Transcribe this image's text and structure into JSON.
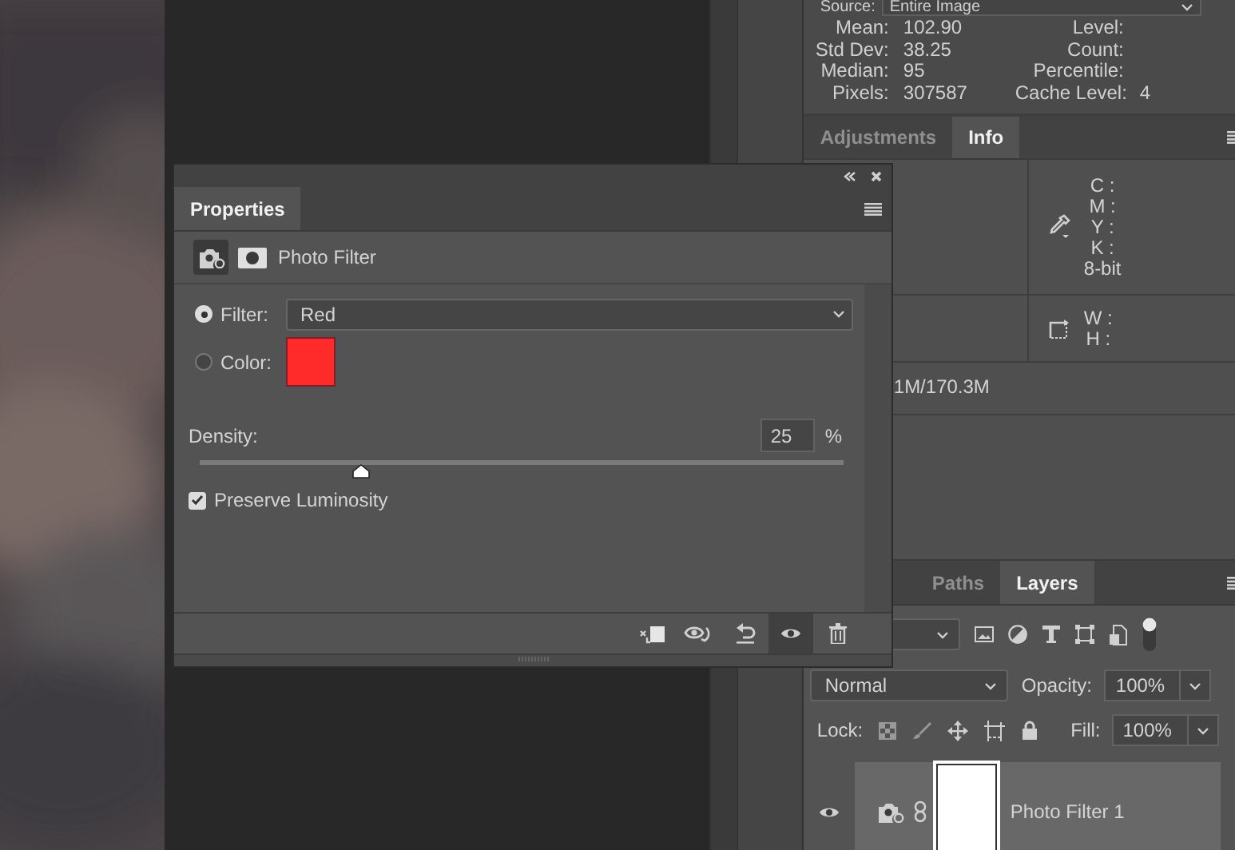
{
  "histogram": {
    "source_label": "Source:",
    "source_value": "Entire Image",
    "stats_left": [
      {
        "label": "Mean:",
        "value": "102.90"
      },
      {
        "label": "Std Dev:",
        "value": "38.25"
      },
      {
        "label": "Median:",
        "value": "95"
      },
      {
        "label": "Pixels:",
        "value": "307587"
      }
    ],
    "stats_right": [
      {
        "label": "Level:"
      },
      {
        "label": "Count:"
      },
      {
        "label": "Percentile:"
      },
      {
        "label": "Cache Level:",
        "value": "4"
      }
    ]
  },
  "info_panel": {
    "tabs": [
      {
        "label": "Adjustments",
        "selected": false
      },
      {
        "label": "Info",
        "selected": true
      }
    ],
    "cmyk_labels": [
      "C :",
      "M :",
      "Y :",
      "K :"
    ],
    "bit_depth": "8-bit",
    "size_labels": [
      "W :",
      "H :"
    ],
    "doc_size": "1M/170.3M"
  },
  "layers_panel": {
    "tabs": [
      {
        "label": "Paths",
        "selected": false
      },
      {
        "label": "Layers",
        "selected": true
      }
    ],
    "blend_mode": "Normal",
    "opacity_label": "Opacity:",
    "opacity": "100%",
    "lock_label": "Lock:",
    "fill_label": "Fill:",
    "fill": "100%",
    "layers": [
      {
        "name": "Photo Filter 1",
        "visible": true,
        "selected": true
      }
    ]
  },
  "properties": {
    "tab": "Properties",
    "title": "Photo Filter",
    "options": [
      {
        "kind": "dropdown",
        "label": "Filter:",
        "selected": true,
        "value": "Red"
      },
      {
        "kind": "swatch",
        "label": "Color:",
        "selected": false,
        "color": "#ff2a2a"
      }
    ],
    "density": {
      "label": "Density:",
      "value": "25",
      "unit": "%",
      "level": 0.25
    },
    "preserve_luminosity": {
      "label": "Preserve Luminosity",
      "checked": true
    },
    "footer_buttons": [
      {
        "kind": "clip",
        "selected": false
      },
      {
        "kind": "view-previous",
        "selected": false
      },
      {
        "kind": "reset",
        "selected": false
      },
      {
        "kind": "visibility",
        "selected": true
      },
      {
        "kind": "delete",
        "selected": false
      }
    ]
  }
}
